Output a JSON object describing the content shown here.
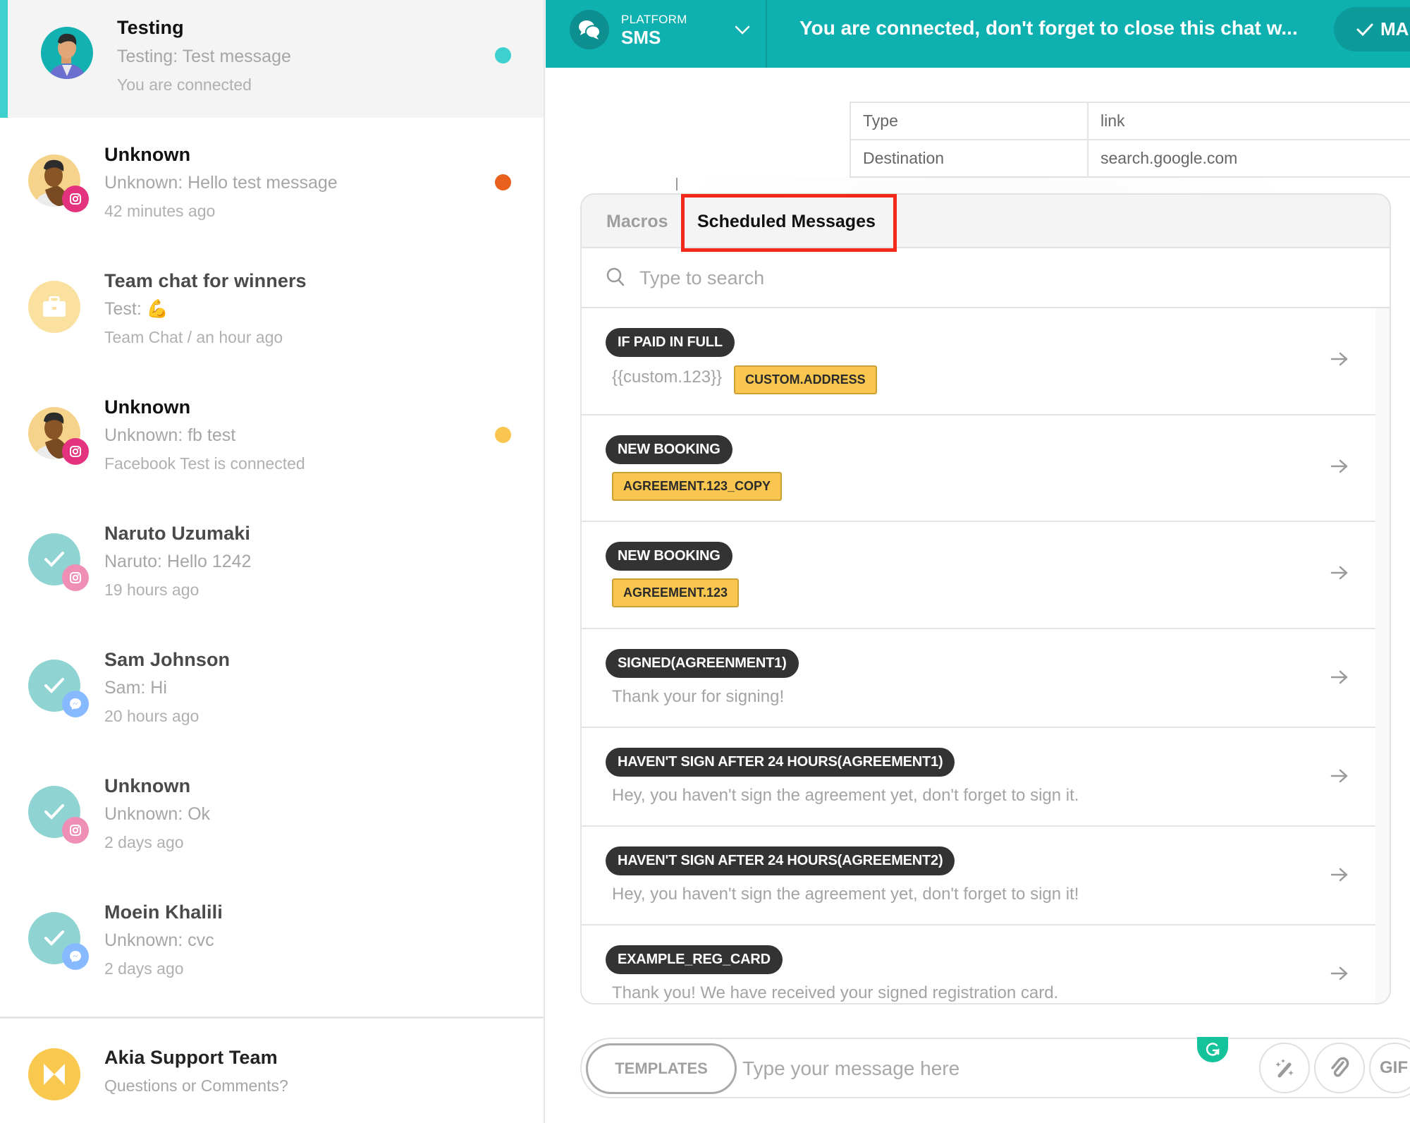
{
  "sidebar": {
    "conversations": [
      {
        "name": "Testing",
        "message": "Testing: Test message",
        "meta": "You are connected",
        "status_color": "#3ecfcf",
        "avatar": "person-avatar-teal",
        "channel": "none",
        "active": true
      },
      {
        "name": "Unknown",
        "message": "Unknown: Hello test message",
        "meta": "42 minutes ago",
        "status_color": "#e8601c",
        "avatar": "person-avatar-yellow",
        "channel": "instagram"
      },
      {
        "name": "Team chat for winners",
        "message": "Test: 💪",
        "meta": "Team Chat / an hour ago",
        "status_color": null,
        "avatar": "briefcase-avatar",
        "channel": "none"
      },
      {
        "name": "Unknown",
        "message": "Unknown: fb test",
        "meta": "Facebook Test is connected",
        "status_color": "#f9c74f",
        "avatar": "person-avatar-yellow",
        "channel": "instagram"
      },
      {
        "name": "Naruto Uzumaki",
        "message": "Naruto: Hello 1242",
        "meta": "19 hours ago",
        "status_color": null,
        "avatar": "resolved-check-avatar",
        "channel": "instagram"
      },
      {
        "name": "Sam Johnson",
        "message": "Sam: Hi",
        "meta": "20 hours ago",
        "status_color": null,
        "avatar": "resolved-check-avatar",
        "channel": "messenger"
      },
      {
        "name": "Unknown",
        "message": "Unknown: Ok",
        "meta": "2 days ago",
        "status_color": null,
        "avatar": "resolved-check-avatar",
        "channel": "instagram"
      },
      {
        "name": "Moein Khalili",
        "message": "Unknown: cvc",
        "meta": "2 days ago",
        "status_color": null,
        "avatar": "resolved-check-avatar",
        "channel": "messenger"
      }
    ],
    "support": {
      "name": "Akia Support Team",
      "subtitle": "Questions or Comments?"
    }
  },
  "header": {
    "platform_label": "PLATFORM",
    "platform_value": "SMS",
    "banner": "You are connected, don't forget to close this chat w...",
    "mark_button": "MAI",
    "accent_color": "#0fb0b0"
  },
  "info_table": [
    {
      "key": "Type",
      "value": "link"
    },
    {
      "key": "Destination",
      "value": "search.google.com"
    }
  ],
  "templates_panel": {
    "tabs": [
      {
        "label": "Macros",
        "active": false
      },
      {
        "label": "Scheduled Messages",
        "active": true
      }
    ],
    "search_placeholder": "Type to search",
    "items": [
      {
        "title": "IF PAID IN FULL",
        "text": "{{custom.123}}",
        "tags": [
          "CUSTOM.ADDRESS"
        ]
      },
      {
        "title": "NEW BOOKING",
        "text": "",
        "tags": [
          "AGREEMENT.123_COPY"
        ]
      },
      {
        "title": "NEW BOOKING",
        "text": "",
        "tags": [
          "AGREEMENT.123"
        ]
      },
      {
        "title": "SIGNED(AGREENMENT1)",
        "text": "Thank your for signing!",
        "tags": []
      },
      {
        "title": "HAVEN'T SIGN AFTER 24 HOURS(AGREEMENT1)",
        "text": "Hey, you haven't sign the agreement yet, don't forget to sign it.",
        "tags": []
      },
      {
        "title": "HAVEN'T SIGN AFTER 24 HOURS(AGREEMENT2)",
        "text": "Hey, you haven't sign the agreement yet, don't forget to sign it!",
        "tags": []
      },
      {
        "title": "EXAMPLE_REG_CARD",
        "text": "Thank you! We have received your signed registration card.",
        "tags": []
      }
    ]
  },
  "composer": {
    "templates_button": "TEMPLATES",
    "placeholder": "Type your message here",
    "gif_button": "GIF"
  }
}
